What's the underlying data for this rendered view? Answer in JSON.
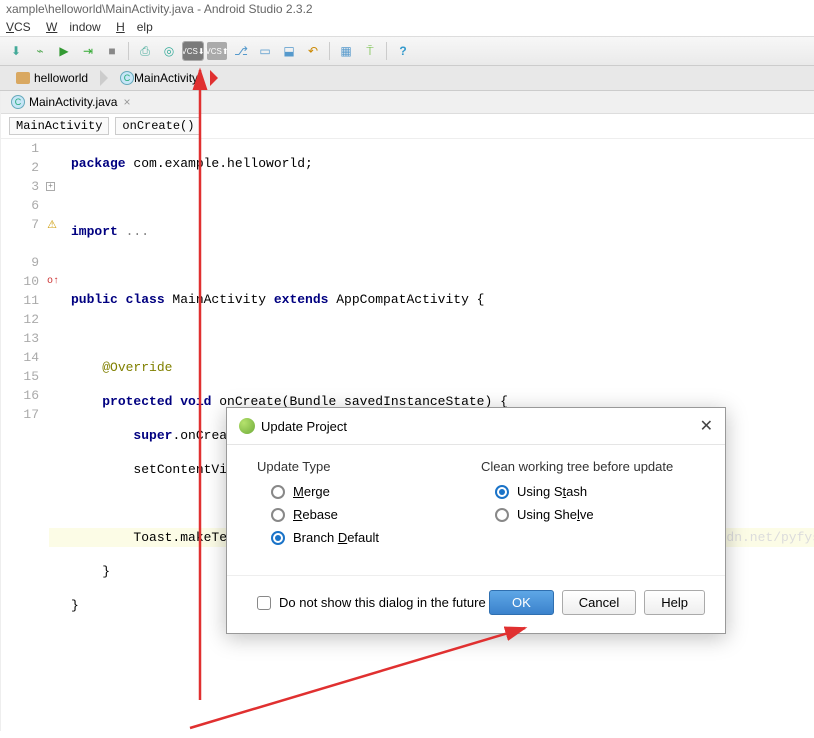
{
  "window": {
    "title": "xample\\helloworld\\MainActivity.java - Android Studio 2.3.2"
  },
  "menu": {
    "vcs": "VCS",
    "window": "Window",
    "help": "Help"
  },
  "breadcrumb": {
    "folder": "helloworld",
    "file": "MainActivity"
  },
  "tab": {
    "name": "MainActivity.java",
    "close": "×"
  },
  "navcrumbs": {
    "class": "MainActivity",
    "method": "onCreate()"
  },
  "code": {
    "lines": [
      "package com.example.helloworld;",
      "",
      "import ...",
      "",
      "public class MainActivity extends AppCompatActivity {",
      "",
      "    @Override",
      "    protected void onCreate(Bundle savedInstanceState) {",
      "        super.onCreate(savedInstanceState);",
      "        setContentView(R.layout.activity_main);",
      "",
      "        Toast.makeText(this,\"HelloWorld\",Toast.LENGTH_SHORT).show();",
      "    }",
      "}",
      ""
    ],
    "watermark": "http://blog.csdn.net/pyfysf"
  },
  "gutter": {
    "numbers": [
      "1",
      "2",
      "3",
      "6",
      "7",
      "",
      "9",
      "10",
      "11",
      "12",
      "13",
      "14",
      "15",
      "16",
      "17"
    ]
  },
  "dialog": {
    "title": "Update Project",
    "sections": {
      "updateType": "Update Type",
      "cleanTree": "Clean working tree before update"
    },
    "options": {
      "merge": "Merge",
      "rebase": "Rebase",
      "branchDefault": "Branch Default",
      "usingStash": "Using Stash",
      "usingShelve": "Using Shelve"
    },
    "doNotShow": "Do not show this dialog in the future",
    "buttons": {
      "ok": "OK",
      "cancel": "Cancel",
      "help": "Help"
    }
  }
}
